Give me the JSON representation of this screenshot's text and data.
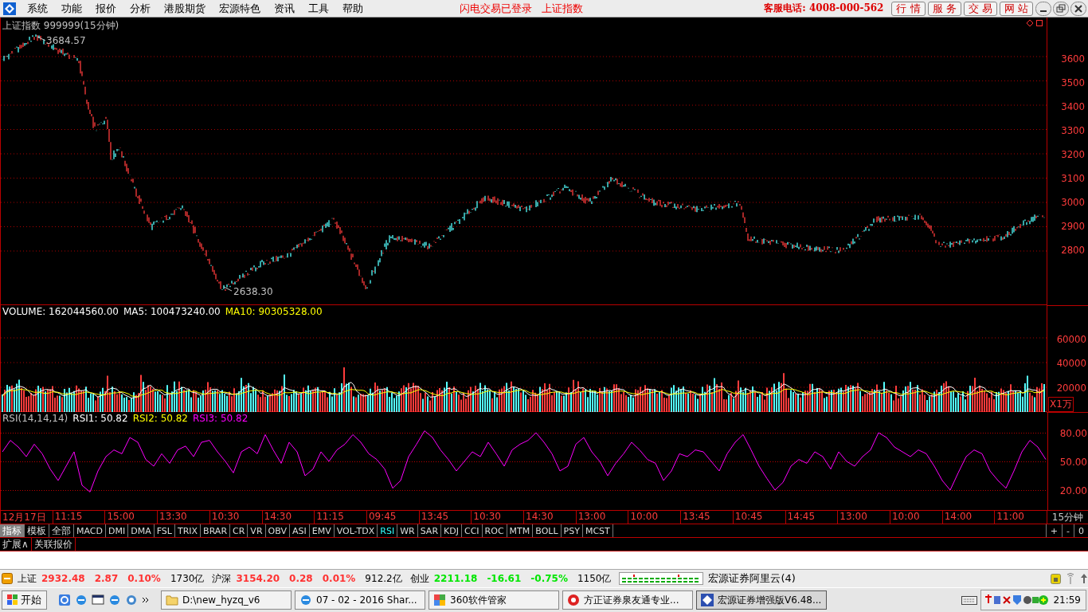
{
  "menu_bar": {
    "items": [
      "系统",
      "功能",
      "报价",
      "分析",
      "港股期货",
      "宏源特色",
      "资讯",
      "工具",
      "帮助"
    ],
    "login_status": "闪电交易已登录",
    "security": "上证指数",
    "hotline": "客服电话: 4008-000-562",
    "buttons": [
      "行 情",
      "服 务",
      "交 易",
      "网 站"
    ]
  },
  "price_pane": {
    "title": "上证指数 999999(15分钟)",
    "high_label": "3684.57",
    "low_label": "2638.30",
    "axis_labels": [
      "3600",
      "3500",
      "3400",
      "3300",
      "3200",
      "3100",
      "3000",
      "2900",
      "2800"
    ]
  },
  "volume_pane": {
    "readouts": [
      {
        "text": "VOLUME: 162044560.00",
        "color": "#ffffff"
      },
      {
        "text": "MA5: 100473240.00",
        "color": "#ffffff"
      },
      {
        "text": "MA10: 90305328.00",
        "color": "#ffff00"
      }
    ],
    "axis_labels": [
      "60000",
      "40000",
      "20000"
    ],
    "unit": "X1万"
  },
  "rsi_pane": {
    "readouts": [
      {
        "text": "RSI(14,14,14)",
        "color": "#c0c0c0"
      },
      {
        "text": "RSI1: 50.82",
        "color": "#ffffff"
      },
      {
        "text": "RSI2: 50.82",
        "color": "#ffff00"
      },
      {
        "text": "RSI3: 50.82",
        "color": "#ff00ff"
      }
    ],
    "chart_data": {
      "type": "line",
      "grid": true,
      "ylim": [
        0,
        100
      ],
      "yticks": [
        {
          "value": 80,
          "label": "80.00"
        },
        {
          "value": 50,
          "label": "50.00"
        },
        {
          "value": 20,
          "label": "20.00"
        }
      ],
      "series": [
        {
          "color": "#ff00ff",
          "values": [
            60,
            72,
            65,
            55,
            68,
            58,
            42,
            30,
            45,
            60,
            25,
            18,
            40,
            55,
            62,
            58,
            75,
            70,
            52,
            45,
            58,
            48,
            62,
            66,
            55,
            70,
            72,
            60,
            50,
            38,
            60,
            65,
            58,
            78,
            62,
            48,
            70,
            60,
            35,
            42,
            60,
            50,
            62,
            68,
            78,
            70,
            58,
            52,
            42,
            22,
            30,
            55,
            68,
            82,
            75,
            62,
            52,
            40,
            50,
            60,
            55,
            70,
            58,
            45,
            62,
            68,
            72,
            80,
            70,
            58,
            40,
            45,
            68,
            75,
            60,
            50,
            35,
            48,
            58,
            70,
            62,
            52,
            48,
            30,
            40,
            58,
            55,
            62,
            60,
            50,
            40,
            58,
            70,
            78,
            62,
            45,
            32,
            20,
            28,
            45,
            52,
            48,
            60,
            55,
            42,
            60,
            50,
            45,
            55,
            62,
            80,
            75,
            65,
            60,
            55,
            62,
            58,
            45,
            30,
            20,
            38,
            55,
            62,
            58,
            40,
            30,
            22,
            40,
            60,
            72,
            65,
            52
          ]
        }
      ]
    }
  },
  "time_axis": {
    "labels": [
      "12月17日",
      "11:15",
      "15:00",
      "13:30",
      "10:30",
      "14:30",
      "11:15",
      "09:45",
      "13:45",
      "10:30",
      "14:30",
      "13:00",
      "10:00",
      "13:45",
      "10:45",
      "14:45",
      "13:00",
      "10:00",
      "14:00",
      "11:00"
    ],
    "period": "15分钟"
  },
  "indicator_bar": {
    "tabs": [
      {
        "label": "指标",
        "selected": true
      },
      {
        "label": "模板",
        "selected": false
      },
      {
        "label": "全部",
        "selected": false
      }
    ],
    "indicators": [
      {
        "label": "MACD",
        "selected": false
      },
      {
        "label": "DMI",
        "selected": false
      },
      {
        "label": "DMA",
        "selected": false
      },
      {
        "label": "FSL",
        "selected": false
      },
      {
        "label": "TRIX",
        "selected": false
      },
      {
        "label": "BRAR",
        "selected": false
      },
      {
        "label": "CR",
        "selected": false
      },
      {
        "label": "VR",
        "selected": false
      },
      {
        "label": "OBV",
        "selected": false
      },
      {
        "label": "ASI",
        "selected": false
      },
      {
        "label": "EMV",
        "selected": false
      },
      {
        "label": "VOL-TDX",
        "selected": false
      },
      {
        "label": "RSI",
        "selected": true
      },
      {
        "label": "WR",
        "selected": false
      },
      {
        "label": "SAR",
        "selected": false
      },
      {
        "label": "KDJ",
        "selected": false
      },
      {
        "label": "CCI",
        "selected": false
      },
      {
        "label": "ROC",
        "selected": false
      },
      {
        "label": "MTM",
        "selected": false
      },
      {
        "label": "BOLL",
        "selected": false
      },
      {
        "label": "PSY",
        "selected": false
      },
      {
        "label": "MCST",
        "selected": false
      }
    ],
    "zoom_buttons": [
      "+",
      "-",
      "0"
    ]
  },
  "bottom_tabs": [
    "扩展∧",
    "关联报价"
  ],
  "status_bar": {
    "indices": [
      {
        "name": "上证",
        "value": "2932.48",
        "change": "2.87",
        "percent": "0.10%",
        "turnover": "1730亿",
        "color": "#ff3232"
      },
      {
        "name": "沪深",
        "value": "3154.20",
        "change": "0.28",
        "percent": "0.01%",
        "turnover": "912.2亿",
        "color": "#ff3232"
      },
      {
        "name": "创业",
        "value": "2211.18",
        "change": "-16.61",
        "percent": "-0.75%",
        "turnover": "1150亿",
        "color": "#00e600"
      }
    ],
    "server": "宏源证券阿里云(4)"
  },
  "taskbar": {
    "start": "开始",
    "windows": [
      {
        "label": "D:\\new_hyzq_v6",
        "kind": "folder",
        "selected": false
      },
      {
        "label": "07 - 02 - 2016 Shar...",
        "kind": "browser",
        "selected": false
      },
      {
        "label": "360软件管家",
        "kind": "app",
        "selected": false
      },
      {
        "label": "方正证券泉友通专业...",
        "kind": "swirl",
        "selected": false
      },
      {
        "label": "宏源证券增强版V6.48...",
        "kind": "diamond",
        "selected": true
      }
    ],
    "clock": "21:59"
  }
}
